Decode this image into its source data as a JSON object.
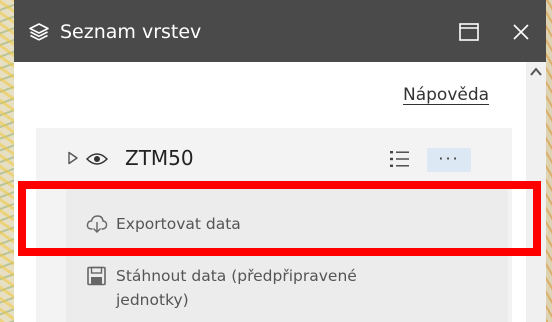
{
  "window": {
    "title": "Seznam vrstev",
    "icons": {
      "title": "layers-icon",
      "maximize": "maximize-icon",
      "close": "close-icon"
    }
  },
  "toolbar": {
    "help_label": "Nápověda"
  },
  "layer": {
    "name": "ZTM50",
    "icons": {
      "expand": "caret-right-icon",
      "visibility": "eye-icon",
      "legend": "legend-list-icon"
    },
    "more_label": "···"
  },
  "menu": {
    "items": [
      {
        "label": "Exportovat data",
        "icon": "cloud-download-icon"
      },
      {
        "label": "Stáhnout data (předpřipravené jednotky)",
        "icon": "floppy-disk-icon"
      }
    ]
  },
  "colors": {
    "titlebar": "#4a4a4a",
    "highlight": "#ff0000",
    "more_button_bg": "#dde8f5"
  }
}
